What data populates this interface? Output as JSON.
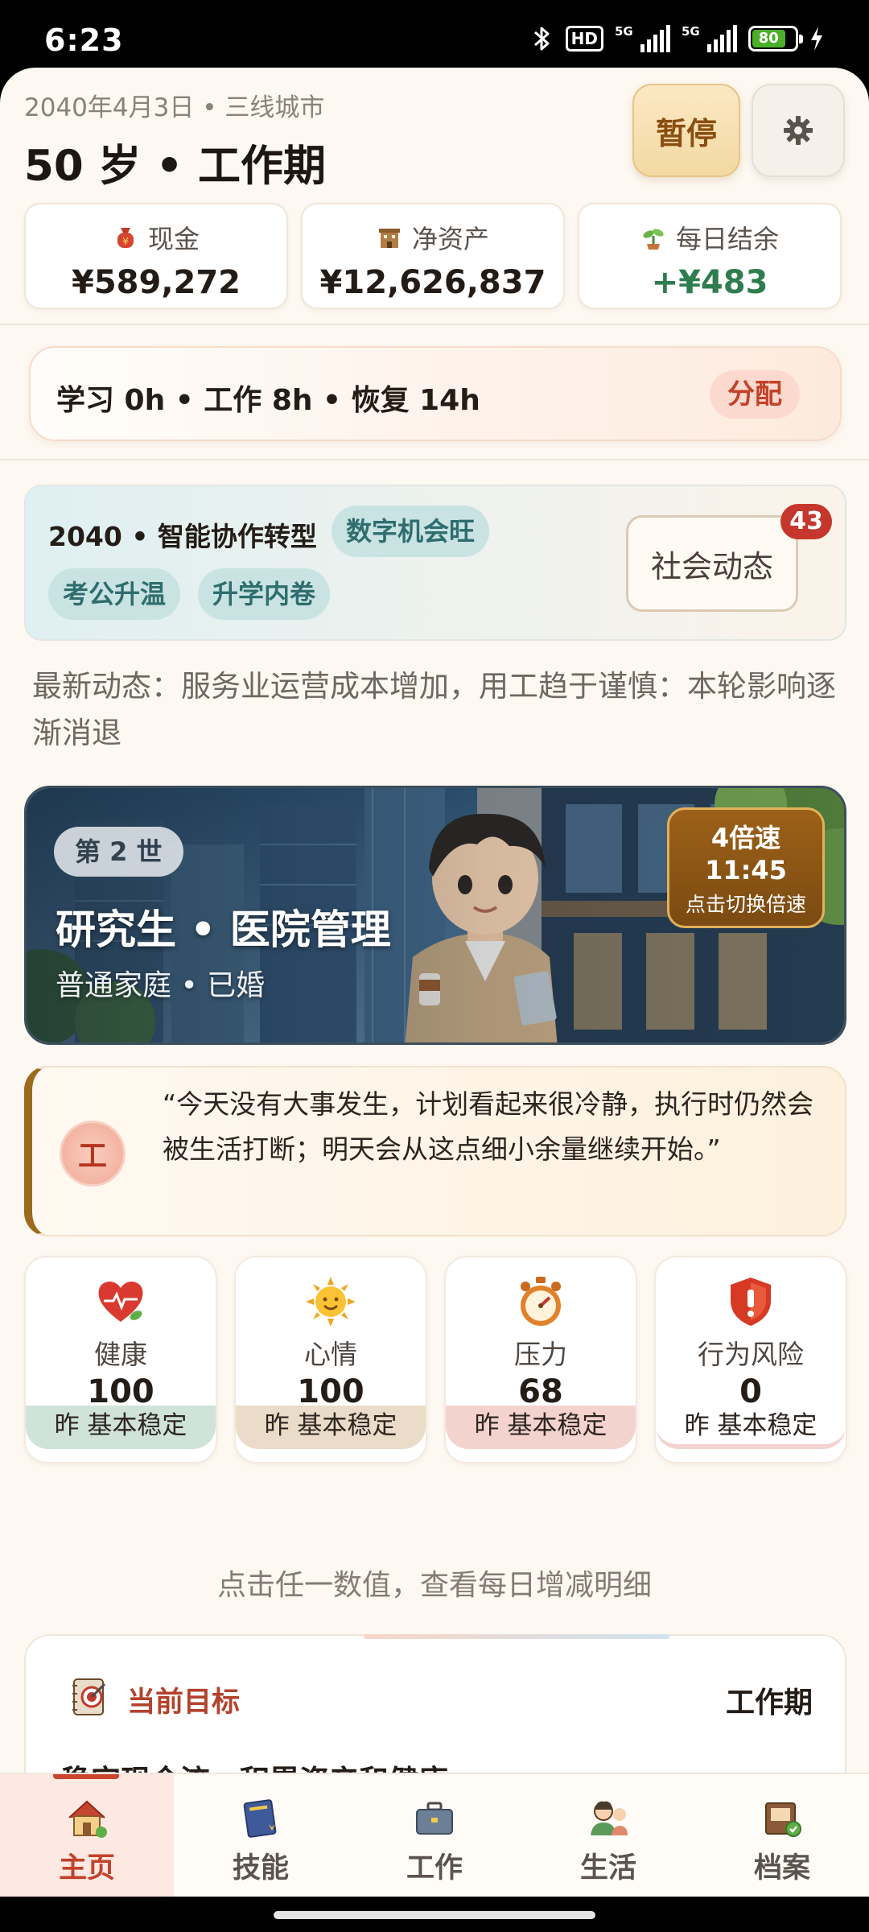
{
  "status_bar": {
    "time": "6:23",
    "hd": "HD",
    "net1": "5G",
    "net2": "5G",
    "battery": "80"
  },
  "header": {
    "date_city": "2040年4月3日 • 三线城市",
    "age_phase": "50 岁 • 工作期",
    "pause_label": "暂停"
  },
  "stats": [
    {
      "label": "现金",
      "value": "¥589,272"
    },
    {
      "label": "净资产",
      "value": "¥12,626,837"
    },
    {
      "label": "每日结余",
      "value": "+¥483"
    }
  ],
  "allocation": {
    "text": "学习 0h • 工作 8h • 恢复 14h",
    "button": "分配"
  },
  "trend": {
    "title": "2040 • 智能协作转型",
    "chips": [
      "数字机会旺",
      "考公升温",
      "升学内卷"
    ],
    "social_button": "社会动态",
    "social_badge": "43"
  },
  "news": "最新动态：服务业运营成本增加，用工趋于谨慎：本轮影响逐渐消退",
  "hero": {
    "generation": "第 2 世",
    "education_job": "研究生 • 医院管理",
    "family_status": "普通家庭 • 已婚",
    "speed": {
      "multiplier": "4倍速",
      "clock": "11:45",
      "hint": "点击切换倍速"
    }
  },
  "quote": {
    "avatar_char": "工",
    "text": "“今天没有大事发生，计划看起来很冷静，执行时仍然会被生活打断；明天会从这点细小余量继续开始。”"
  },
  "metrics": [
    {
      "name": "健康",
      "value": "100",
      "yesterday": "昨 基本稳定",
      "icon": "heart-icon",
      "level": 1.0
    },
    {
      "name": "心情",
      "value": "100",
      "yesterday": "昨 基本稳定",
      "icon": "sun-icon",
      "level": 1.0
    },
    {
      "name": "压力",
      "value": "68",
      "yesterday": "昨 基本稳定",
      "icon": "stopwatch-icon",
      "level": 0.68
    },
    {
      "name": "行为风险",
      "value": "0",
      "yesterday": "昨 基本稳定",
      "icon": "shield-icon",
      "level": 0.0
    }
  ],
  "metrics_hint": "点击任一数值，查看每日增减明细",
  "goal": {
    "title": "当前目标",
    "phase": "工作期",
    "description": "稳定现金流，积累资产和健康"
  },
  "tabs": [
    {
      "label": "主页",
      "icon": "house-icon",
      "active": true
    },
    {
      "label": "技能",
      "icon": "book-icon",
      "active": false
    },
    {
      "label": "工作",
      "icon": "briefcase-icon",
      "active": false
    },
    {
      "label": "生活",
      "icon": "people-icon",
      "active": false
    },
    {
      "label": "档案",
      "icon": "archive-icon",
      "active": false
    }
  ],
  "colors": {
    "accent_red": "#c2412a",
    "positive_green": "#2e7d4f",
    "gold": "#9b6a1c"
  }
}
